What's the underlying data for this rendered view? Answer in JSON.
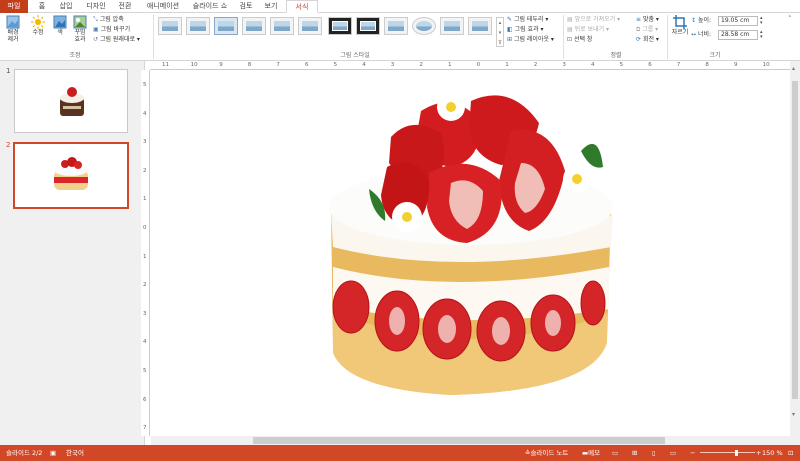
{
  "tabs": [
    "파일",
    "홈",
    "삽입",
    "디자인",
    "전환",
    "애니메이션",
    "슬라이드 쇼",
    "검토",
    "보기",
    "서식"
  ],
  "active_tab": "서식",
  "ribbon": {
    "adjust": {
      "bg_remove": "배경\n제거",
      "corrections": "수정",
      "color": "색",
      "artistic": "꾸밈\n효과",
      "compress": "그림 압축",
      "change": "그림 바꾸기",
      "reset": "그림 원래대로",
      "label": "조정"
    },
    "styles_label": "그림 스타일",
    "style_effects": {
      "border": "그림 테두리",
      "effects": "그림 효과",
      "layout": "그림 레이아웃"
    },
    "arrange": {
      "forward": "앞으로 가져오기",
      "backward": "뒤로 보내기",
      "selection": "선택 창",
      "align": "맞춤",
      "group": "그룹",
      "rotate": "회전",
      "label": "정렬"
    },
    "size": {
      "crop": "자르기",
      "height_label": "높이:",
      "height": "19.05 cm",
      "width_label": "너비:",
      "width": "28.58 cm",
      "label": "크기"
    }
  },
  "slides": [
    {
      "num": "1"
    },
    {
      "num": "2"
    }
  ],
  "ruler_h": [
    "11",
    "10",
    "9",
    "8",
    "7",
    "6",
    "5",
    "4",
    "3",
    "2",
    "1",
    "0",
    "1",
    "2",
    "3",
    "4",
    "5",
    "6",
    "7",
    "8",
    "9",
    "10",
    "11"
  ],
  "ruler_v": [
    "5",
    "4",
    "3",
    "2",
    "1",
    "0",
    "1",
    "2",
    "3",
    "4",
    "5",
    "6",
    "7"
  ],
  "status": {
    "slide": "슬라이드 2/2",
    "lang": "한국어",
    "notes": "슬라이드 노트",
    "comments": "메모",
    "zoom": "150 %"
  },
  "colors": {
    "accent": "#c43e1c",
    "status_bar": "#d24726"
  }
}
